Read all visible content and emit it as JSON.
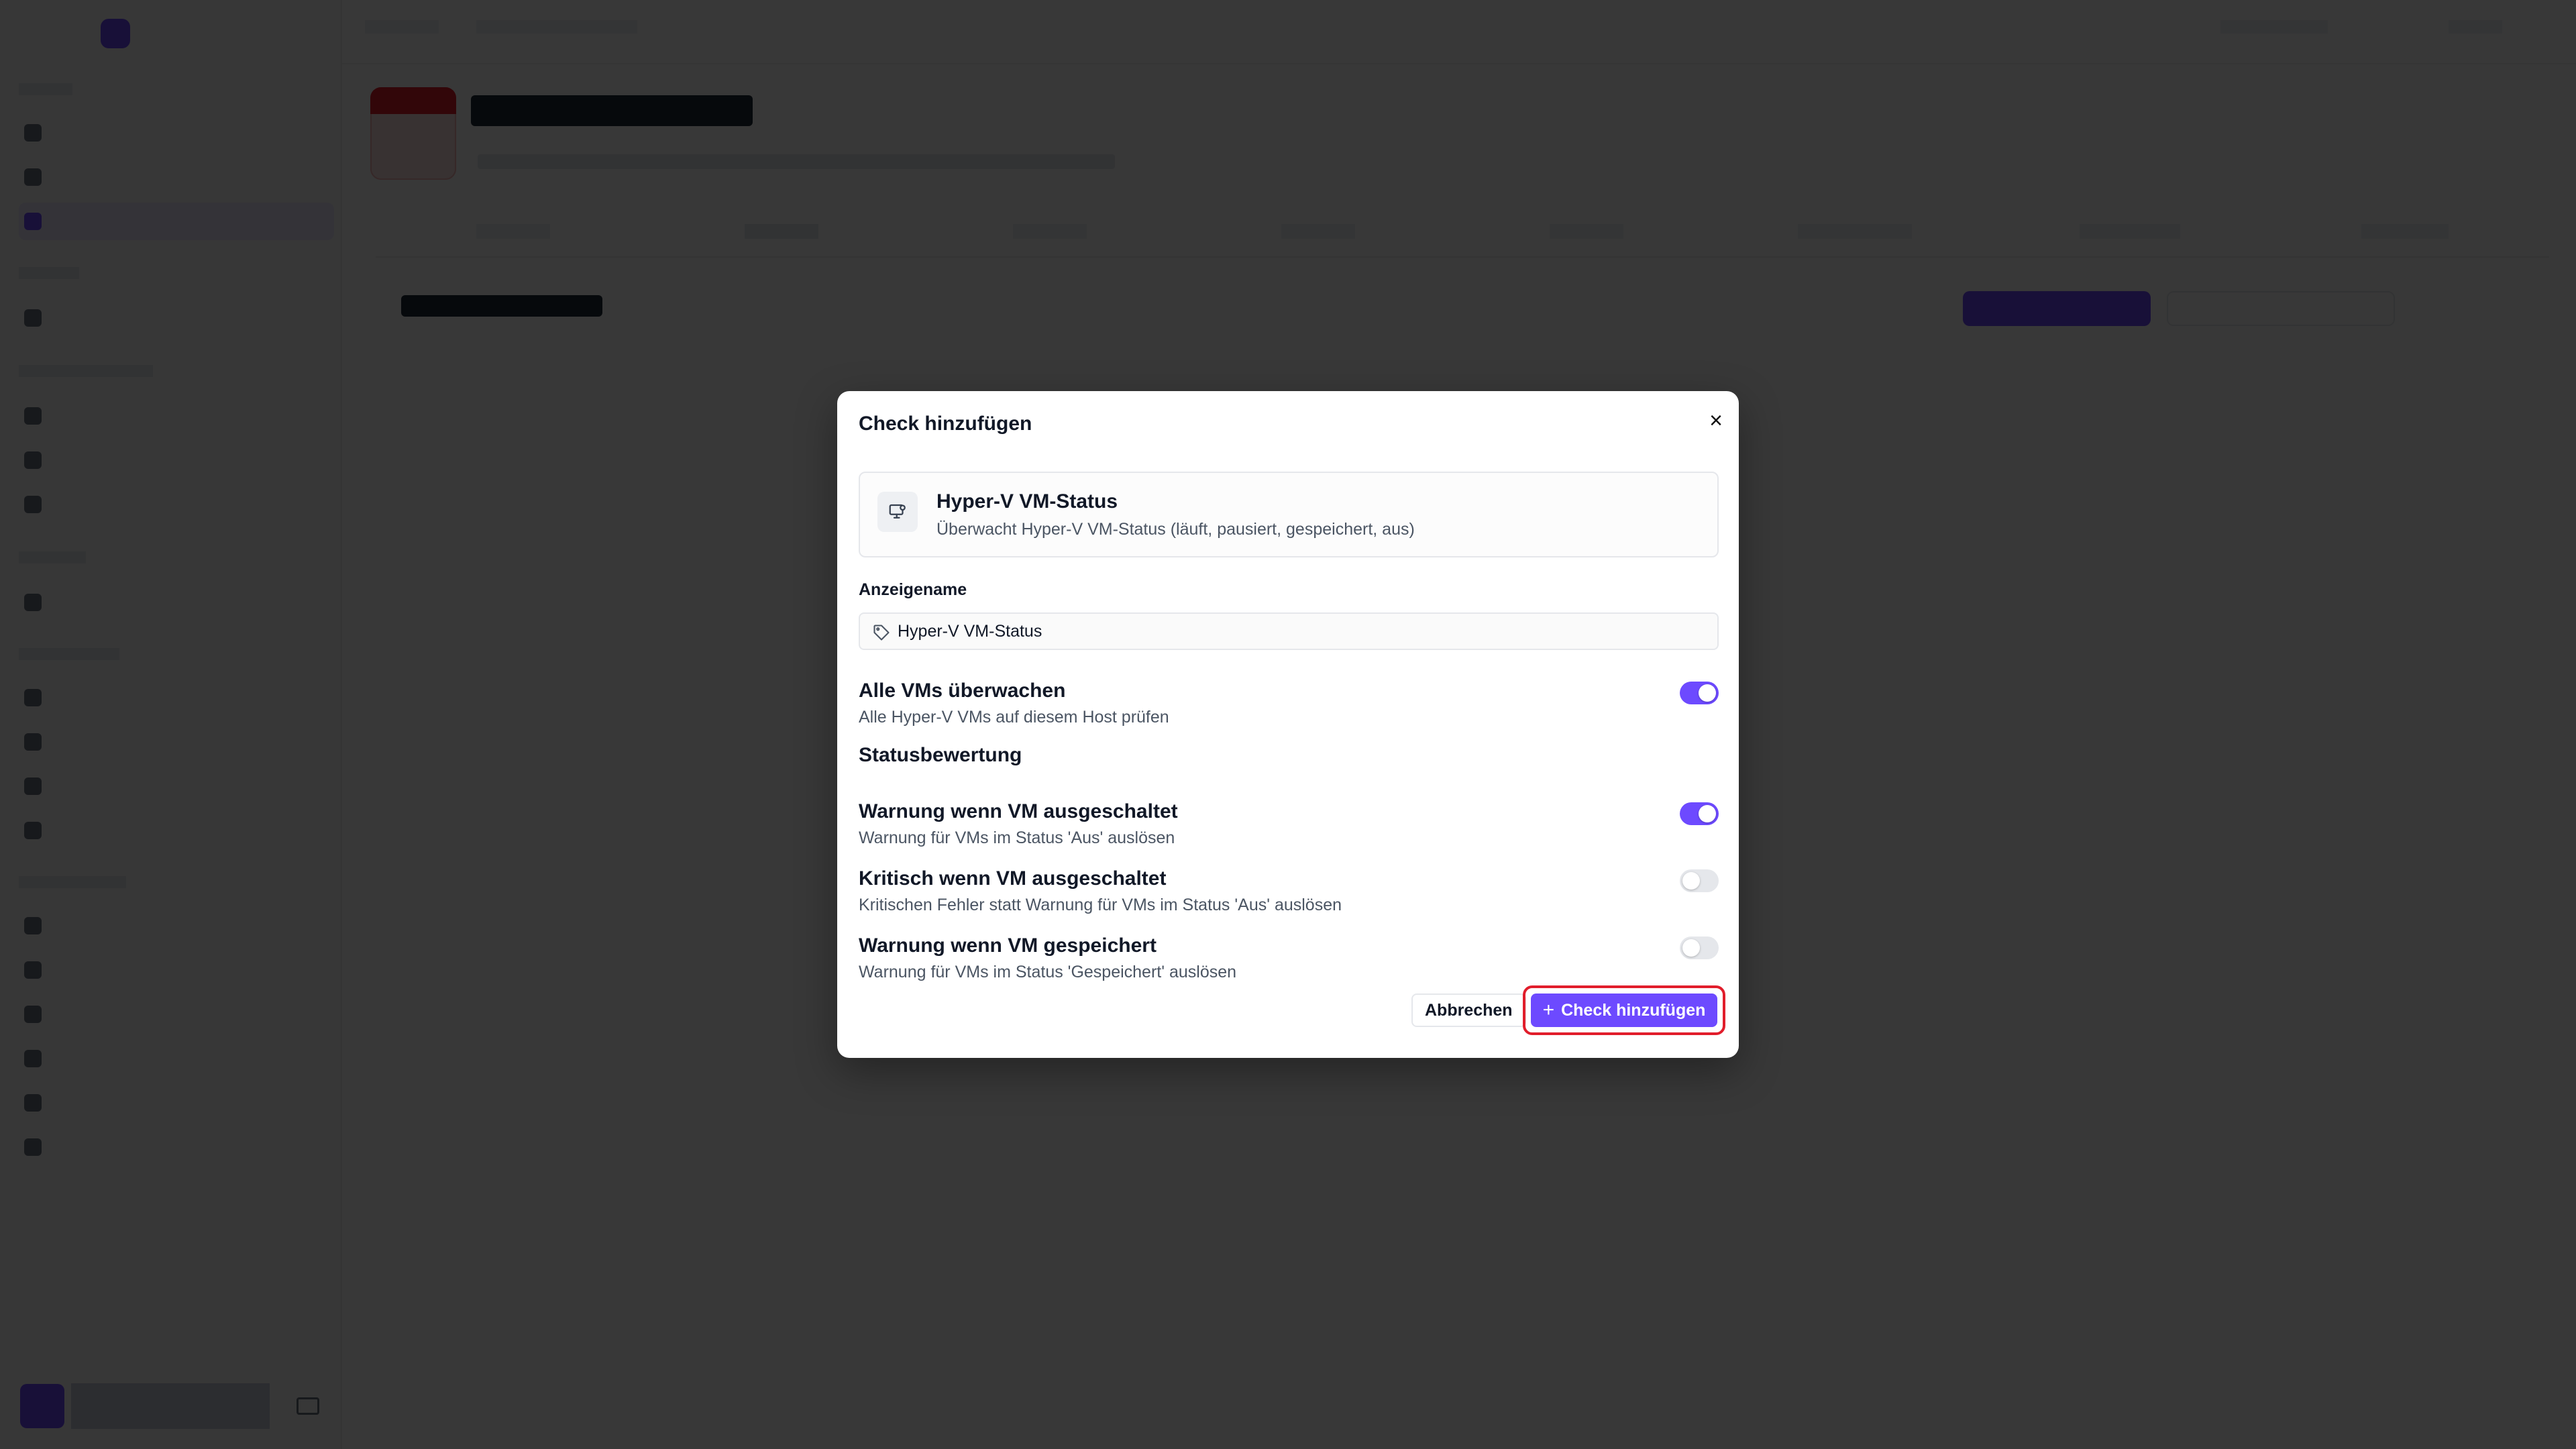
{
  "dialog": {
    "title": "Check hinzufügen",
    "check": {
      "name": "Hyper-V VM-Status",
      "description": "Überwacht Hyper-V VM-Status (läuft, pausiert, gespeichert, aus)",
      "icon": "monitor-gear-icon"
    },
    "display_name": {
      "label": "Anzeigename",
      "value": "Hyper-V VM-Status",
      "icon": "tag-icon"
    },
    "all_vms": {
      "title": "Alle VMs überwachen",
      "description": "Alle Hyper-V VMs auf diesem Host prüfen",
      "enabled": true
    },
    "status_section_title": "Statusbewertung",
    "options": [
      {
        "title": "Warnung wenn VM ausgeschaltet",
        "description": "Warnung für VMs im Status 'Aus' auslösen",
        "enabled": true
      },
      {
        "title": "Kritisch wenn VM ausgeschaltet",
        "description": "Kritischen Fehler statt Warnung für VMs im Status 'Aus' auslösen",
        "enabled": false
      },
      {
        "title": "Warnung wenn VM gespeichert",
        "description": "Warnung für VMs im Status 'Gespeichert' auslösen",
        "enabled": false
      }
    ],
    "cancel_label": "Abbrechen",
    "submit_label": "Check hinzufügen",
    "submit_icon": "plus-icon"
  },
  "colors": {
    "accent": "#6d4aff",
    "highlight": "#e11d2b",
    "overlay": "rgba(0,0,0,0.78)"
  }
}
